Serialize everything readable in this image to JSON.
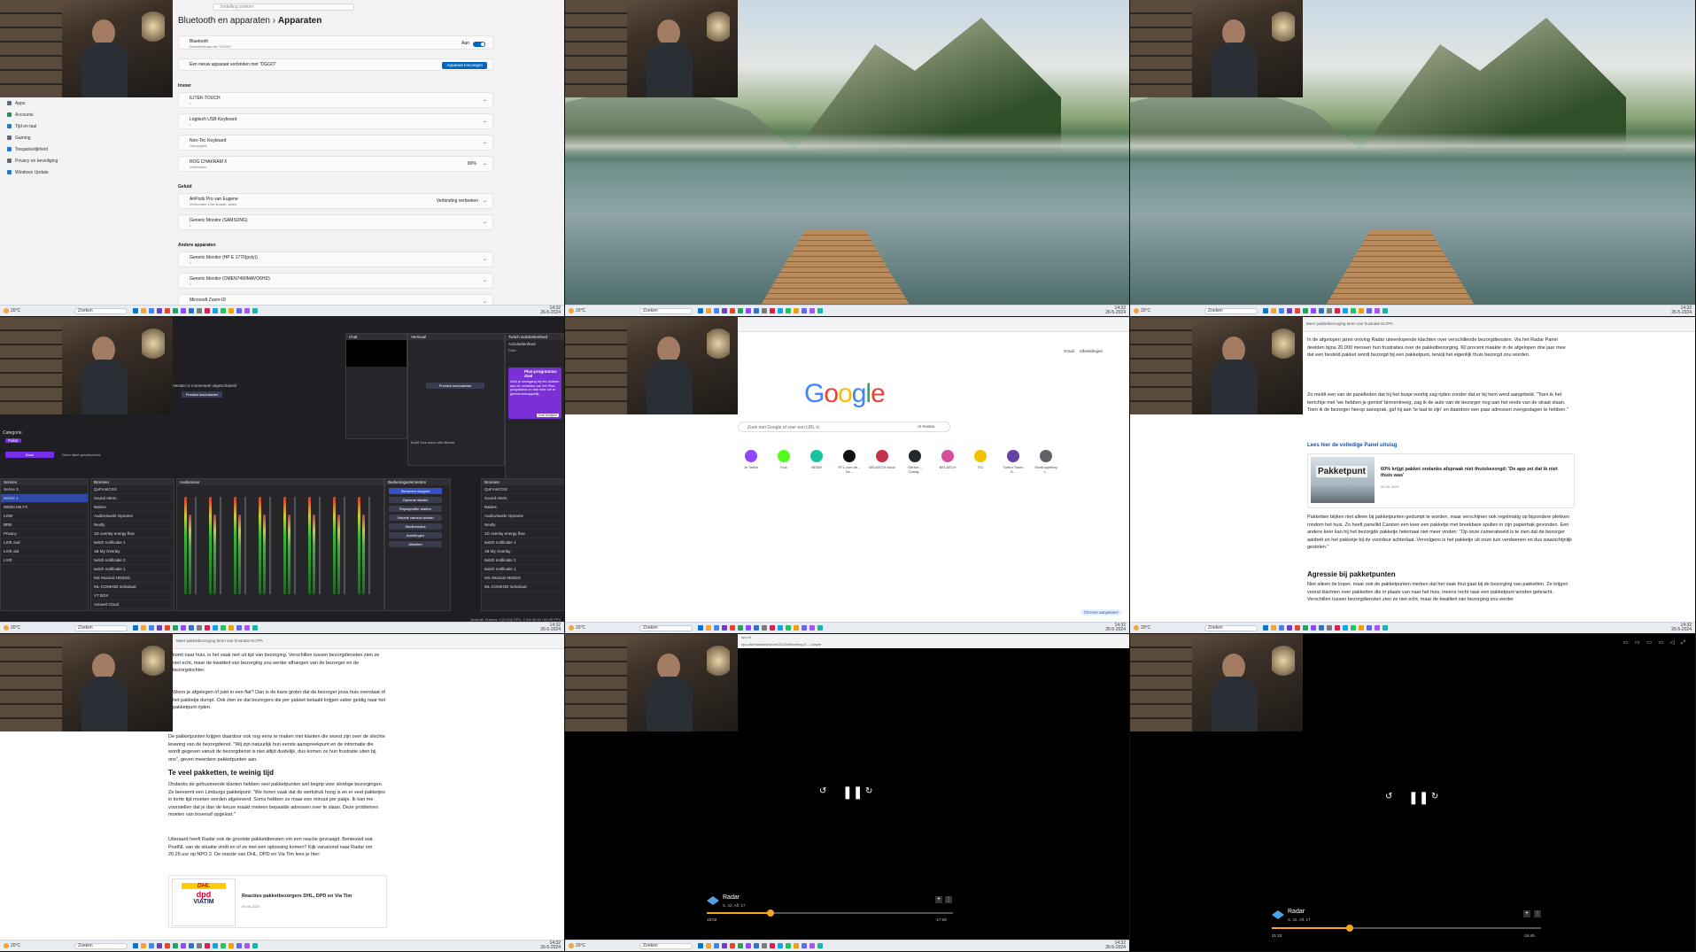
{
  "panel1": {
    "search_placeholder": "Instelling zoeken",
    "breadcrumb_parent": "Bluetooth en apparaten",
    "breadcrumb_sep": "›",
    "breadcrumb_current": "Apparaten",
    "bluetooth": {
      "title": "Bluetooth",
      "sub": "Detecteerbaar als \"DGGO\"",
      "state": "Aan"
    },
    "pair_text": "Een nieuw apparaat verbinden met \"DGGO\"",
    "add_button": "Apparaat toevoegen",
    "nav": [
      {
        "label": "Apps",
        "color": "#5f6b7a"
      },
      {
        "label": "Accounts",
        "color": "#2e8b57"
      },
      {
        "label": "Tijd en taal",
        "color": "#2b74c7"
      },
      {
        "label": "Gaming",
        "color": "#5f6b7a"
      },
      {
        "label": "Toegankelijkheid",
        "color": "#2b74c7"
      },
      {
        "label": "Privacy en beveiliging",
        "color": "#5f6b7a"
      },
      {
        "label": "Windows Update",
        "color": "#2b74c7"
      }
    ],
    "section_input": "Invoer",
    "input_devices": [
      {
        "title": "ILITEK-TOUCH",
        "sub": "•"
      },
      {
        "title": "Logitech USB Keyboard",
        "sub": "•"
      },
      {
        "title": "Non-Tec Keyboard",
        "sub": "Gekoppeld"
      },
      {
        "title": "ROG CHAKRAM X",
        "sub": "Verbonden",
        "extra": "80%"
      }
    ],
    "section_audio": "Geluid",
    "audio_devices": [
      {
        "title": "AirPods Pro van Eugene",
        "sub": "Verbonden voor spraak, audio",
        "action": "Verbinding verbreken"
      },
      {
        "title": "Generic Monitor (SAMSUNG)",
        "sub": "•"
      }
    ],
    "section_other": "Andere apparaten",
    "other_devices": [
      {
        "title": "Generic Monitor (HP E 1770(poly))",
        "sub": "•"
      },
      {
        "title": "Generic Monitor (OMEN7490MAVO6HD)",
        "sub": "•"
      },
      {
        "title": "Microsoft Zoom-ID",
        "sub": ""
      }
    ]
  },
  "taskbar": {
    "weather_temp": "20°C",
    "weather_text": "Zonnig",
    "search": "Zoeken",
    "time": "14:32",
    "date": "26-5-2024"
  },
  "obs": {
    "preview_text": "Venster is momenteel uitgeschakeld",
    "preview_button": "Preview inschakelen",
    "chat_title": "Chat",
    "vertical_title": "Verticaal",
    "twitch_title": "Twitch activiteitenfeed",
    "activity_title": "Activiteitenfeed",
    "filter_label": "Filter",
    "plus_title": "Plus-programma-doel",
    "plus_text": "Deel je voortgang bij het voldoen aan de vereisten van het Plus-programma en doe mee om er gemeenschappelijk.",
    "plus_button": "Doel bekijken",
    "category_label": "Categorie",
    "category_value": "Poker",
    "clear_button": "Klaar",
    "no_tag": "Geen label geselecteerd",
    "scenes_title": "Scènes",
    "scenes": [
      "Scène 3",
      "Scène 1",
      "WEBCAM FX",
      "LOW",
      "BRB",
      "Privacy",
      "LIVE oud",
      "LIVE old",
      "LIVE"
    ],
    "sources_title": "Bronnen",
    "sources": [
      "QuFrontCSS",
      "Sound Alerts",
      "Balans",
      "Audiovisuele Opname",
      "Nextly",
      "1D overlay energy flow",
      "twitch notificatie 1",
      "1B My Overlay",
      "twitch notificatie 2",
      "twitch notificatie 1",
      "Mic Musical HDSDG",
      "ML-CONKOB Individual",
      "VT BOX",
      "Actueel Cloud"
    ],
    "audio_title": "Audiomixer",
    "controls_title": "Bedieningselementen",
    "controls": [
      "Streamen stoppen",
      "Opname starten",
      "Replaybuffer starten",
      "Virtuele camera starten",
      "Studiomodus",
      "Instellingen",
      "Afsluiten"
    ],
    "build_text": "Build Your stack with Bitrate",
    "status": "Verbruik: Frames: 0 (0.0%)   CPU: 2.3%   60.00 / 60.00 FPS"
  },
  "google": {
    "link_gmail": "Gmail",
    "link_images": "Afbeeldingen",
    "logo": "Google",
    "search_placeholder": "Zoek met Google of voer een URL in",
    "ai_mode": "AI-modus",
    "shortcuts": [
      {
        "label": "Je Twitch",
        "color": "#9146ff"
      },
      {
        "label": "Kick",
        "color": "#53fc18"
      },
      {
        "label": "BEAM",
        "color": "#19c39c"
      },
      {
        "label": "RTL.com.de – De...",
        "color": "#111111"
      },
      {
        "label": "BELAECH cloud",
        "color": "#c4314b"
      },
      {
        "label": "GitHub – Chang...",
        "color": "#24292e"
      },
      {
        "label": "BELAECH",
        "color": "#d64f9a"
      },
      {
        "label": "TIG",
        "color": "#f2c200"
      },
      {
        "label": "Twitch Token G...",
        "color": "#6441a5"
      },
      {
        "label": "Snelkoppeling t...",
        "color": "#5f6368"
      }
    ],
    "customize": "Chrome aanpassen"
  },
  "article": {
    "url": "Meer pakketbezorging leren van frustratie KLTPA",
    "para1": "In de afgelopen jaren ontving Radar uiteenlopende klachten over verschillende bezorgdiensten. Via het Radar Panel deelden bijna 20.000 mensen hun frustraties over de pakketbezorging. 60 procent maakte in de afgelopen drie jaar mee dat een besteld pakket wordt bezorgd bij een pakketpunt, terwijl het eigenlijk thuis bezorgd zou worden.",
    "para2": "Zo meldt een van de panelleden dat hij het busje voorbij zag rijden zonder dat er bij hem werd aangebeld. \"Toen ik het berichtje met 'we hebben je gemist' binnenkreeg, zag ik de auto van de bezorger nog aan het einde van de straat staan. Toen ik de bezorger hierop aansprak, gaf hij aan 'te laat te zijn' en daardoor een paar adressen overgeslagen te hebben.\"",
    "link_title": "Lees hier de volledige Panel uitslag",
    "thumb_word": "Pakketpunt",
    "card_title": "60% krijgt pakket ondanks afspraak niet thuisbezorgd: 'De app zei dat ik niet thuis was'",
    "card_date": "05-06-2024",
    "para3": "Pakketten blijken niet alleen bij pakketpunten gedumpt te worden, maar verschijnen ook regelmatig op bijzondere plekken rondom het huis. Zo heeft panellid Carsten een keer een pakketje met breekbare spullen in zijn papierbak gevonden. Een andere keer kan hij het bezorgde pakketje helemaal niet meer vinden: \"Op onze camerabeeld is te zien dat de bezorger aanbelt en het pakketje bij de voordeur achterlaat. Vervolgens is het pakketje uit onze tuin verdwenen en dus waarschijnlijk gestolen.\"",
    "heading1": "Agressie bij pakketpunten",
    "para4": "Niet alleen de koper, maar ook de pakketpunten merken dat het vaak fout gaat bij de bezorging van pakketten. Ze krijgen vooral klachten over pakketten die in plaats van naar het huis, ineens recht naar een pakketpunt worden gebracht. Verschillen tussen bezorgdiensten zien ze niet echt, maar de kwaliteit van bezorging zou eerder"
  },
  "article2": {
    "url": "Meer pakketbezorging leren van frustratie KLTPA",
    "para1": "komt naar huis, is het vaak niet uit tijd van bezorging. Verschillen tussen bezorgdiensten zien ze niet echt, maar de kwaliteit van bezorging zou eerder afhangen van de bezorger en de bezorgdochter.",
    "para2": "Woon je afgelegen of juist in een flat? Dan is de kans groter dat de bezorger jouw huis overslaat of het pakketje dumpt. Ook zien ze dat bezorgers die per pakket betaald krijgen vaker geldig naar het pakketpunt rijden.",
    "para3": "De pakketpunten krijgen daardoor ook nog eens te maken met klanten die woest zijn over de slechte levering van de bezorgdienst. \"Wij zijn natuurlijk hun eerste aanspreekpunt en de informatie die wordt gegeven vanuit de bezorgdienst is niet altijd duidelijk, dus komen ze hun frustratie uiten bij ons\", geven meerdere pakketpunten aan.",
    "heading": "Te veel pakketten, te weinig tijd",
    "para4": "Ondanks de gefrustreerde klanten hebben veel pakketpunten wel begrip voor slordige bezorgingen. Ze benoemt een Limburgs pakketpunt: \"We horen vaak dat de werkdruk hoog is en er veel pakketjes in korte tijd moeten worden afgeleverd. Soms hebben ze maar een minuut per pakje. Ik kan me voorstellen dat je dan de keuze maakt meteen bepaalde adressen over te slaan. Deze problemen moeten van bovenaf opgelost.\"",
    "para5": "Uiteraard heeft Radar ook de grootste pakketdiensten om een reactie gevraagd. Benieuwd wat PostNL van de situatie vindt en of ze met een oplossing komen? Kijk vanavond naar Radar om 20.25 uur op NPO 2. De reactie van DHL, DPD en Via Tim lees je hier:",
    "card_title": "Reacties pakketbezorgers DHL, DPD en Via Tim",
    "card_date": "05-06-2024",
    "logo_dhl": "DHL",
    "logo_dpd": "dpd",
    "logo_viatim": "VIATIM"
  },
  "video1": {
    "url_tab": "npo.nl",
    "url": "npo-start/radar/seizoen/2024/aflevering-5 — player",
    "title": "Radar",
    "sub": "S. 22, Afl. 17",
    "time_left": "19:02",
    "time_right": "-17:29",
    "progress": 0.26
  },
  "video2": {
    "title": "Radar",
    "sub": "S. 22, Afl. 17",
    "time_left": "21:33",
    "time_right": "-16:45",
    "progress": 0.29
  },
  "colors": {
    "accent": "#0067c0",
    "video_accent": "#f5a623",
    "obs_bg": "#1f1f23"
  }
}
